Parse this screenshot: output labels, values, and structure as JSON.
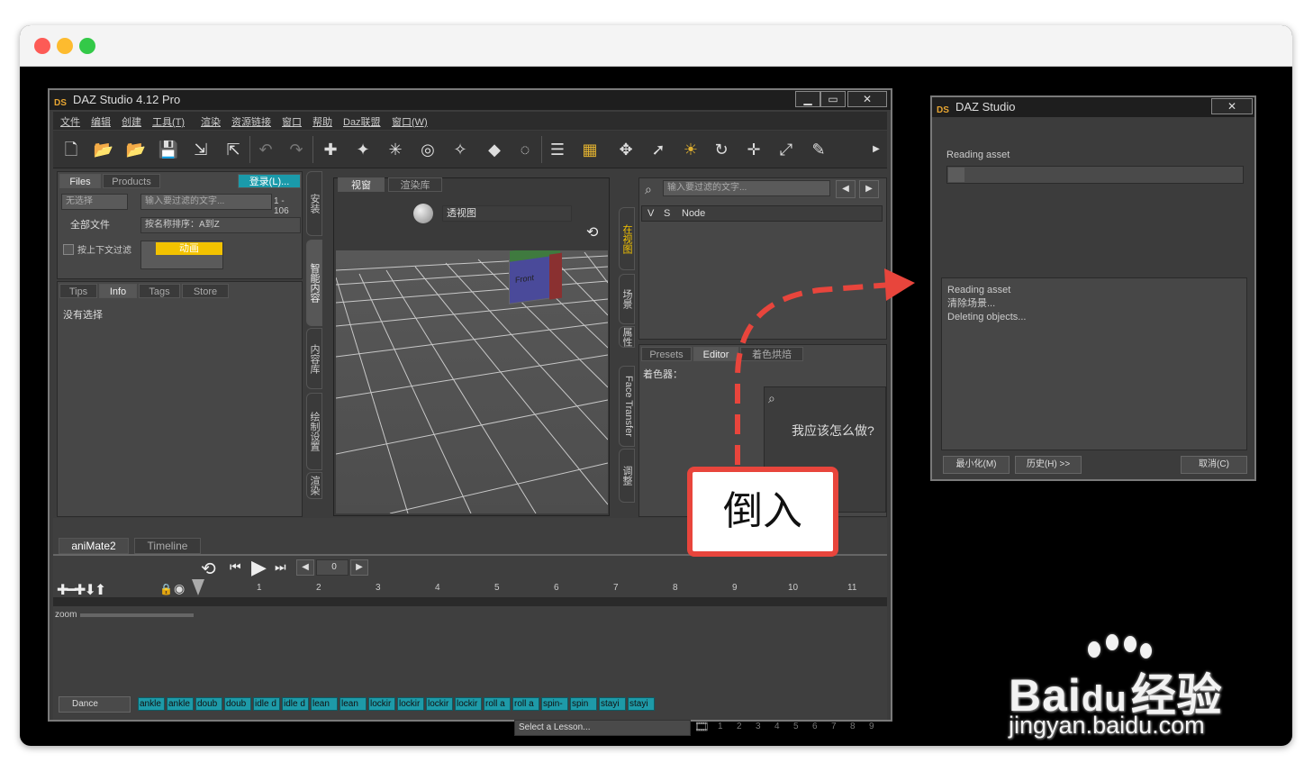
{
  "main_window": {
    "title": "DAZ Studio 4.12 Pro",
    "logo": "DS",
    "controls": {
      "minimize": "▁",
      "maximize": "▭",
      "close": "✕"
    },
    "menu": [
      "文件",
      "编辑",
      "创建",
      "工具(T)",
      "渲染",
      "资源链接",
      "窗口",
      "帮助",
      "Daz联盟",
      "窗口(W)"
    ]
  },
  "left_panel": {
    "tabs": [
      "Files",
      "Products"
    ],
    "login_button": "登录(L)...",
    "filter_dropdown": "无选择",
    "search_placeholder": "输入要过滤的文字...",
    "count": "1 - 106",
    "all_files": "全部文件",
    "sort": "按名称排序：A到Z",
    "filter_context": "按上下文过滤",
    "thumb_label": "动画",
    "info_tabs": [
      "Tips",
      "Info",
      "Tags",
      "Store"
    ],
    "no_selection": "没有选择"
  },
  "side_tabs_left": [
    "安装",
    "智能内容",
    "内容库",
    "绘制设置",
    "渲染"
  ],
  "viewport": {
    "tabs": [
      "视窗",
      "渲染库"
    ],
    "view_mode": "透视图",
    "cube_label": "Front"
  },
  "side_tabs_right": [
    "在视图",
    "场景",
    "属性",
    "Face Transfer",
    "调整"
  ],
  "scene_panel": {
    "search_placeholder": "输入要过滤的文字...",
    "columns": [
      "V",
      "S",
      "Node"
    ]
  },
  "shader_panel": {
    "tabs": [
      "Presets",
      "Editor",
      "着色烘焙"
    ],
    "label": "着色器：",
    "help_text": "我应该怎么做?"
  },
  "animation": {
    "tabs": [
      "aniMate2",
      "Timeline"
    ],
    "frame_value": "0",
    "ticks": [
      "1",
      "2",
      "3",
      "4",
      "5",
      "6",
      "7",
      "8",
      "9",
      "10",
      "11"
    ],
    "zoom_label": "zoom",
    "preset": "Dance",
    "clips": [
      "ankle",
      "ankle",
      "doub",
      "doub",
      "idle d",
      "idle d",
      "lean",
      "lean",
      "lockir",
      "lockir",
      "lockir",
      "lockir",
      "roll a",
      "roll a",
      "spin-",
      "spin",
      "stayi",
      "stayi"
    ],
    "lesson": "Select a Lesson...",
    "pages": [
      "1",
      "2",
      "3",
      "4",
      "5",
      "6",
      "7",
      "8",
      "9"
    ]
  },
  "dialog": {
    "title": "DAZ Studio",
    "logo": "DS",
    "close": "✕",
    "status": "Reading asset",
    "log": [
      "Reading asset",
      "清除场景...",
      "Deleting objects..."
    ],
    "buttons": {
      "minimize": "最小化(M)",
      "history": "历史(H) >>",
      "cancel": "取消(C)"
    }
  },
  "callout": {
    "text": "倒入"
  },
  "watermark": {
    "brand_left": "Bai",
    "brand_mid": "du",
    "brand_right": "经验",
    "url": "jingyan.baidu.com"
  },
  "colors": {
    "accent_red": "#e8453c",
    "clip_teal": "#1e9aa8",
    "login_teal": "#1a9aaa",
    "thumb_yellow": "#f2c200"
  }
}
